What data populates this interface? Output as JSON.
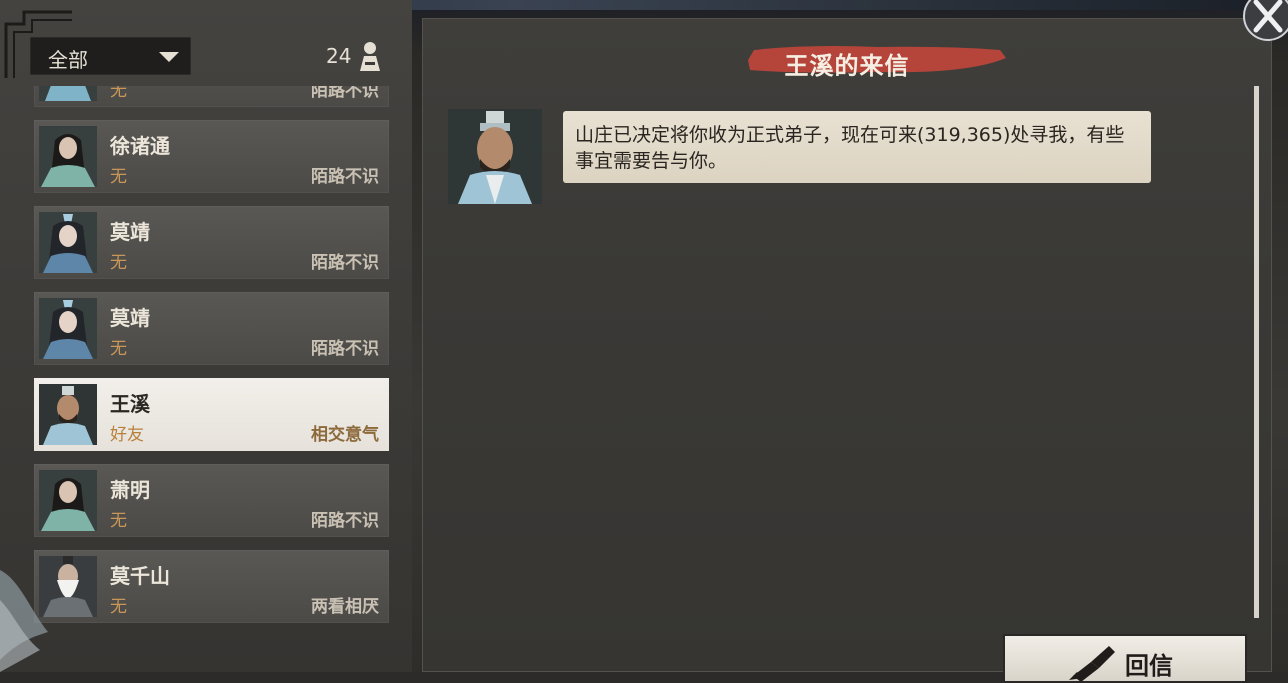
{
  "filter": {
    "label": "全部",
    "count": "24"
  },
  "contacts": [
    {
      "name": "",
      "relation": "无",
      "attitude": "陌路不识",
      "selected": false,
      "avatar": "blue-robed-character"
    },
    {
      "name": "徐诸通",
      "relation": "无",
      "attitude": "陌路不识",
      "selected": false,
      "avatar": "long-haired-youth"
    },
    {
      "name": "莫靖",
      "relation": "无",
      "attitude": "陌路不识",
      "selected": false,
      "avatar": "blue-headdress-maiden"
    },
    {
      "name": "莫靖",
      "relation": "无",
      "attitude": "陌路不识",
      "selected": false,
      "avatar": "blue-headdress-maiden"
    },
    {
      "name": "王溪",
      "relation": "好友",
      "attitude": "相交意气",
      "selected": true,
      "avatar": "bearded-official"
    },
    {
      "name": "萧明",
      "relation": "无",
      "attitude": "陌路不识",
      "selected": false,
      "avatar": "long-haired-youth"
    },
    {
      "name": "莫千山",
      "relation": "无",
      "attitude": "两看相厌",
      "selected": false,
      "avatar": "white-bearded-elder"
    }
  ],
  "letter": {
    "title": "王溪的来信",
    "message": "山庄已决定将你收为正式弟子，现在可来(319,365)处寻我，有些事宜需要告与你。"
  },
  "reply_button": {
    "label": "回信"
  },
  "colors": {
    "ribbon": "#b5453a",
    "relation_accent": "#c99858",
    "selected_card": "#f2efea"
  }
}
